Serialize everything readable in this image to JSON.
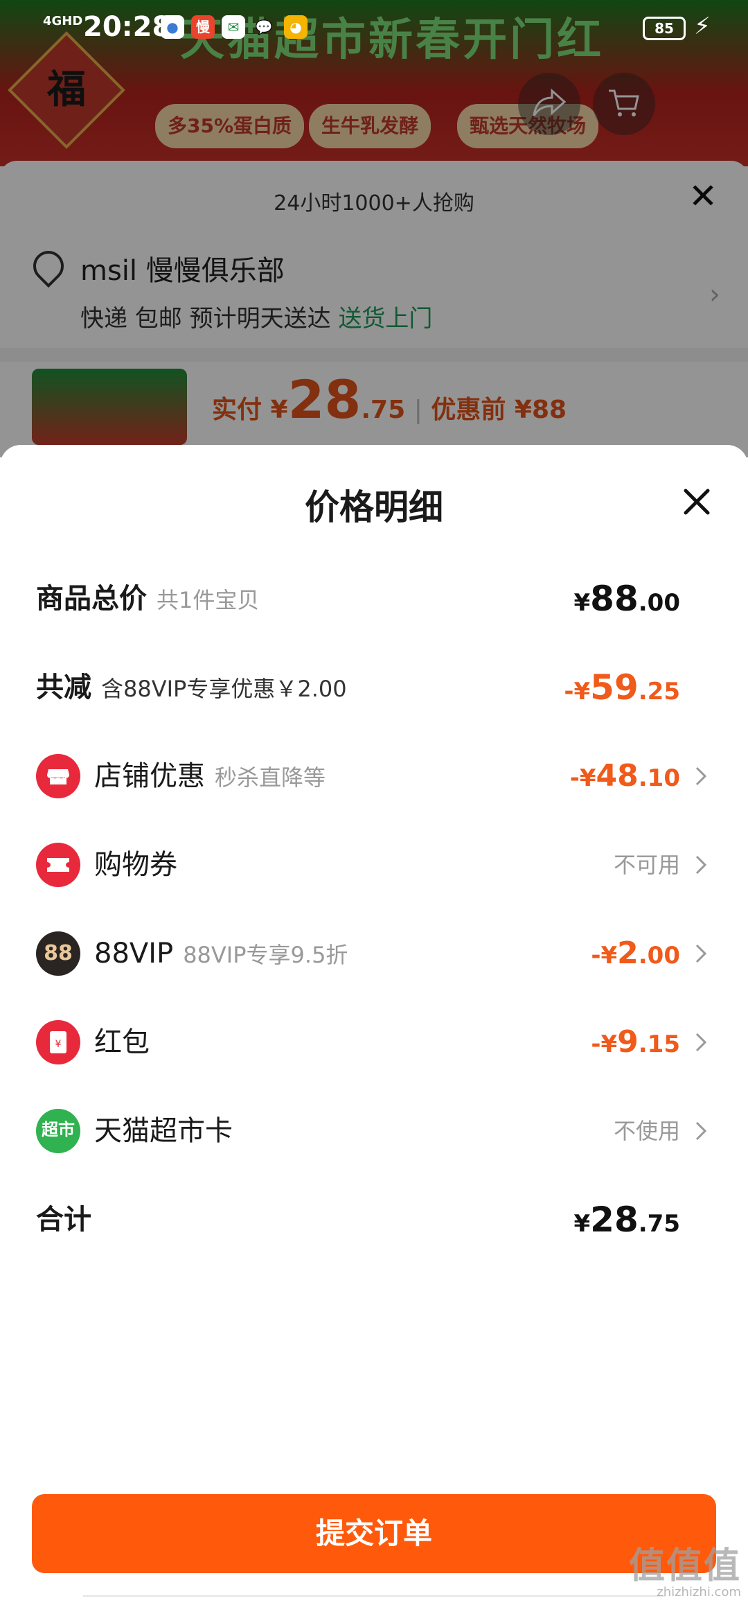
{
  "colors": {
    "accent": "#ff5a0c",
    "discount": "#f05a1a",
    "green": "#1f9a5b"
  },
  "status_bar": {
    "network": "4GHD",
    "time": "20:28",
    "app_icons": [
      "maps-icon",
      "taobao-icon",
      "unicom-icon",
      "message-icon",
      "fruit-app-icon"
    ],
    "app_glyphs": [
      "●",
      "慢",
      "✉",
      "💬",
      "◕"
    ],
    "battery": "85"
  },
  "background": {
    "banner_title": "天猫超市新春开门红",
    "fu": "福",
    "chips": [
      "多35%蛋白质",
      "生牛乳发酵",
      "甄选天然牧场"
    ],
    "hot_text": "24小时1000+人抢购",
    "address_name": "msil 慢慢俱乐部",
    "delivery_prefix": "快递 包邮 预计明天送达",
    "delivery_highlight": "送货上门",
    "price_prefix": "实付 ¥",
    "price_big": "28",
    "price_decimal": ".75",
    "price_sep": "|",
    "price_before": "优惠前 ¥88"
  },
  "modal": {
    "title": "价格明细",
    "rows": {
      "total": {
        "label": "商品总价",
        "sub": "共1件宝贝",
        "cur": "¥",
        "big": "88",
        "small": ".00"
      },
      "reduce": {
        "label": "共减",
        "sub": "含88VIP专享优惠￥2.00",
        "cur": "-¥",
        "big": "59",
        "small": ".25"
      },
      "shop": {
        "label": "店铺优惠",
        "sub": "秒杀直降等",
        "cur": "-¥",
        "big": "48",
        "small": ".10"
      },
      "coupon": {
        "label": "购物券",
        "value": "不可用"
      },
      "vip": {
        "icon_text": "88",
        "label": "88VIP",
        "sub": "88VIP专享9.5折",
        "cur": "-¥",
        "big": "2",
        "small": ".00"
      },
      "redpacket": {
        "label": "红包",
        "cur": "-¥",
        "big": "9",
        "small": ".15"
      },
      "card": {
        "icon_text": "超市",
        "label": "天猫超市卡",
        "value": "不使用"
      },
      "sum": {
        "label": "合计",
        "cur": "¥",
        "big": "28",
        "small": ".75"
      }
    },
    "submit_label": "提交订单"
  },
  "watermark": {
    "big": "值值值",
    "small": "zhizhizhi.com"
  }
}
